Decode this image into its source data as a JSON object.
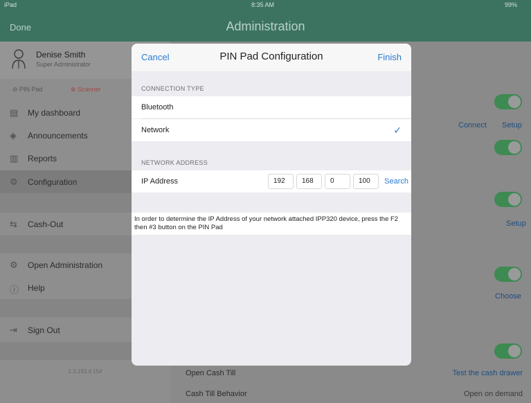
{
  "status_bar": {
    "carrier": "iPad",
    "time": "8:35 AM",
    "battery": "99%"
  },
  "nav": {
    "done_label": "Done",
    "title": "Administration"
  },
  "sidebar": {
    "user": {
      "name": "Denise Smith",
      "role": "Super Administrator"
    },
    "devices": {
      "pin_pad": "PIN Pad",
      "scanner": "Scanner"
    },
    "items": [
      {
        "label": "My dashboard",
        "icon": "dashboard-icon"
      },
      {
        "label": "Announcements",
        "icon": "megaphone-icon"
      },
      {
        "label": "Reports",
        "icon": "report-icon"
      },
      {
        "label": "Configuration",
        "icon": "gear-icon"
      },
      {
        "label": "Cash-Out",
        "icon": "cash-icon"
      },
      {
        "label": "Open Administration",
        "icon": "gear-icon"
      },
      {
        "label": "Help",
        "icon": "help-icon"
      },
      {
        "label": "Sign Out",
        "icon": "sign-out-icon"
      }
    ],
    "version": "1.3.193.4.154"
  },
  "main": {
    "connect_label": "Connect",
    "setup_label_1": "Setup",
    "setup_label_2": "Setup",
    "choose_label": "Choose",
    "open_cash_till": "Open Cash Till",
    "test_cash_drawer": "Test the cash drawer",
    "cash_till_behavior": "Cash Till Behavior",
    "open_on_demand": "Open on demand"
  },
  "modal": {
    "cancel_label": "Cancel",
    "title": "PIN Pad Configuration",
    "finish_label": "Finish",
    "connection_type_header": "CONNECTION TYPE",
    "options": [
      {
        "label": "Bluetooth",
        "selected": false
      },
      {
        "label": "Network",
        "selected": true
      }
    ],
    "checkmark": "✓",
    "network_address_header": "NETWORK ADDRESS",
    "ip_label": "IP Address",
    "ip_octets": [
      "192",
      "168",
      "0",
      "100"
    ],
    "search_label": "Search",
    "info_text": "In order to determine the IP Address of your network attached IPP320 device, press the F2 then #3 button on the PIN Pad"
  },
  "colors": {
    "header": "#3c7360",
    "accent_blue": "#2a7ad3",
    "toggle_green": "#3d8a52"
  }
}
